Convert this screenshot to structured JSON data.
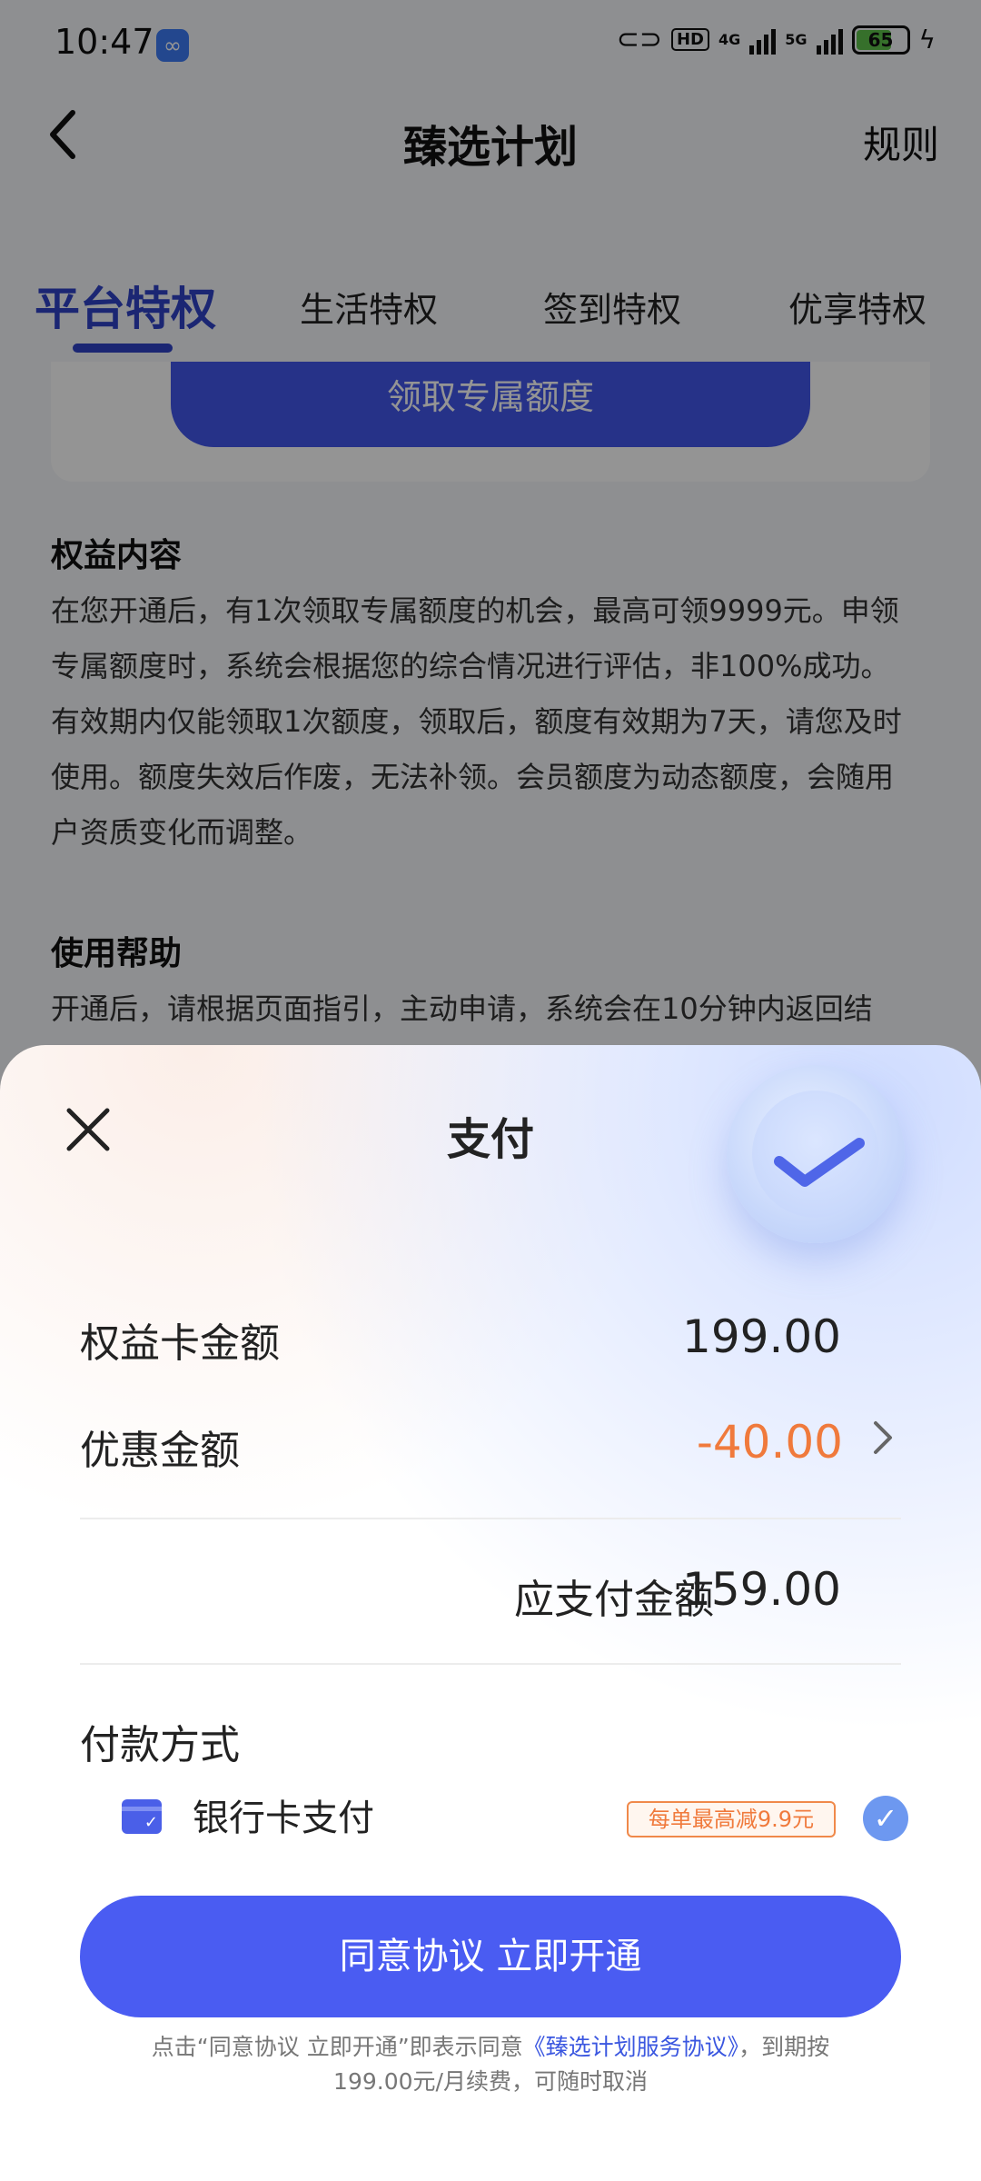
{
  "status_bar": {
    "time": "10:47",
    "hd": "HD",
    "net1": "4G",
    "net2": "5G",
    "battery": "65"
  },
  "nav": {
    "back_icon": "chevron-left-icon",
    "title": "臻选计划",
    "rules": "规则"
  },
  "tabs": [
    {
      "label": "平台特权",
      "active": true
    },
    {
      "label": "生活特权"
    },
    {
      "label": "签到特权"
    },
    {
      "label": "优享特权"
    }
  ],
  "quota_button": "领取专属额度",
  "benefits": {
    "title": "权益内容",
    "lines": [
      "在您开通后，有1次领取专属额度的机会，最高可领9999元。申领",
      "专属额度时，系统会根据您的综合情况进行评估，非100%成功。",
      "有效期内仅能领取1次额度，领取后，额度有效期为7天，请您及时",
      "使用。额度失效后作废，无法补领。会员额度为动态额度，会随用",
      "户资质变化而调整。"
    ]
  },
  "help": {
    "title": "使用帮助",
    "line": "开通后，请根据页面指引，主动申请，系统会在10分钟内返回结"
  },
  "payment": {
    "title": "支付",
    "close_icon": "close-icon",
    "card_amount_label": "权益卡金额",
    "card_amount": "199.00",
    "discount_label": "优惠金额",
    "discount": "-40.00",
    "due_label": "应支付金额",
    "due": "159.00",
    "method_title": "付款方式",
    "method_label": "银行卡支付",
    "method_badge": "每单最高减9.9元",
    "cta": "同意协议 立即开通",
    "agreement_prefix": "点击“同意协议 立即开通”即表示同意",
    "agreement_link": "《臻选计划服务协议》",
    "agreement_suffix": "，到期按",
    "agreement_line2": "199.00元/月续费，可随时取消"
  },
  "colors": {
    "accent": "#4a5cf2",
    "tab_active": "#2f43c6",
    "discount": "#f07a3c",
    "link": "#3b57e0"
  }
}
